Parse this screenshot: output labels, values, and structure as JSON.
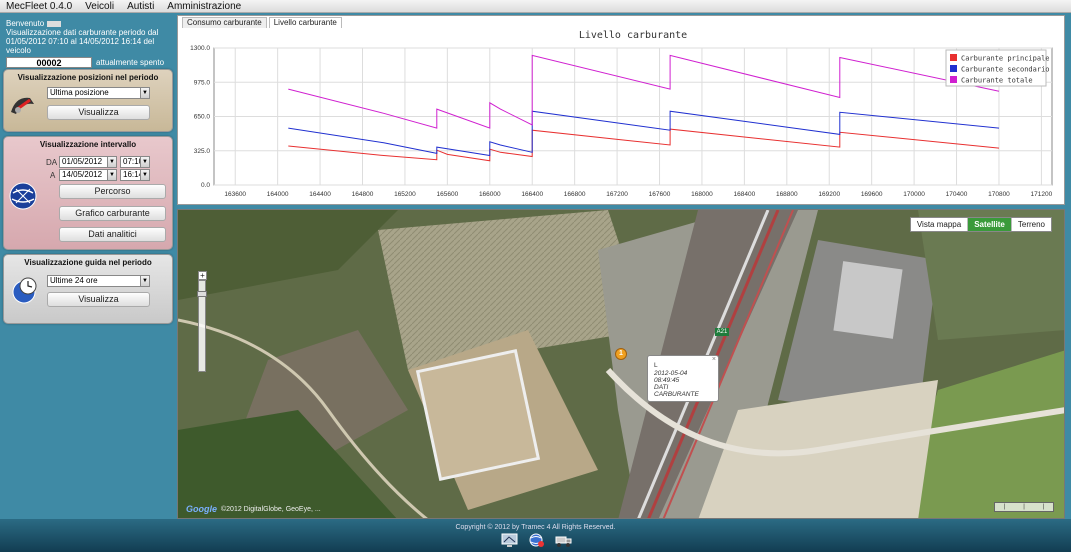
{
  "menu": {
    "app_title": "MecFleet 0.4.0",
    "items": [
      "Veicoli",
      "Autisti",
      "Amministrazione"
    ]
  },
  "welcome": {
    "greeting": "Benvenuto",
    "line1": "Visualizzazione dati carburante periodo dal",
    "line2": "01/05/2012 07:10 al 14/05/2012 16:14 del veicolo",
    "vehicle_code": "00002",
    "status": "attualmente spento"
  },
  "positions_panel": {
    "title": "Visualizzazione posizioni nel periodo",
    "select_value": "Ultima posizione",
    "button": "Visualizza"
  },
  "interval_panel": {
    "title": "Visualizzazione intervallo",
    "from_label": "DA",
    "to_label": "A",
    "from_date": "01/05/2012",
    "from_time": "07:10",
    "to_date": "14/05/2012",
    "to_time": "16:14",
    "buttons": [
      "Percorso",
      "Grafico carburante",
      "Dati analitici"
    ]
  },
  "driving_panel": {
    "title": "Visualizzazione guida nel periodo",
    "select_value": "Ultime 24 ore",
    "button": "Visualizza"
  },
  "chart_tabs": [
    "Consumo carburante",
    "Livello carburante"
  ],
  "chart_data": {
    "type": "line",
    "title": "Livello carburante",
    "xlim": [
      163400,
      171300
    ],
    "ylim": [
      0,
      1300
    ],
    "x_ticks": [
      163600,
      164000,
      164400,
      164800,
      165200,
      165600,
      166000,
      166400,
      166800,
      167200,
      167600,
      168000,
      168400,
      168800,
      169200,
      169600,
      170000,
      170400,
      170800,
      171200
    ],
    "y_ticks": [
      "0.0",
      "325.0",
      "650.0",
      "975.0",
      "1300.0"
    ],
    "grid": true,
    "legend_position": "top-right",
    "series": [
      {
        "name": "Carburante principale",
        "color": "#e83030",
        "points": [
          [
            164100,
            370
          ],
          [
            165000,
            280
          ],
          [
            165500,
            240
          ],
          [
            165500,
            330
          ],
          [
            165600,
            290
          ],
          [
            166000,
            230
          ],
          [
            166000,
            340
          ],
          [
            166100,
            310
          ],
          [
            166400,
            270
          ],
          [
            166400,
            520
          ],
          [
            167700,
            380
          ],
          [
            167700,
            530
          ],
          [
            169300,
            360
          ],
          [
            169300,
            500
          ],
          [
            170800,
            350
          ]
        ]
      },
      {
        "name": "Carburante secondario",
        "color": "#2030d0",
        "points": [
          [
            164100,
            540
          ],
          [
            165000,
            400
          ],
          [
            165500,
            300
          ],
          [
            165500,
            360
          ],
          [
            166000,
            280
          ],
          [
            166000,
            410
          ],
          [
            166100,
            380
          ],
          [
            166400,
            310
          ],
          [
            166400,
            700
          ],
          [
            167700,
            520
          ],
          [
            167700,
            700
          ],
          [
            169300,
            480
          ],
          [
            169300,
            690
          ],
          [
            170800,
            540
          ]
        ]
      },
      {
        "name": "Carburante totale",
        "color": "#d020d0",
        "points": [
          [
            164100,
            910
          ],
          [
            165000,
            680
          ],
          [
            165500,
            540
          ],
          [
            165500,
            720
          ],
          [
            166000,
            540
          ],
          [
            166000,
            780
          ],
          [
            166100,
            720
          ],
          [
            166400,
            570
          ],
          [
            166400,
            1230
          ],
          [
            167700,
            910
          ],
          [
            167700,
            1230
          ],
          [
            169300,
            830
          ],
          [
            169300,
            1210
          ],
          [
            170800,
            890
          ]
        ]
      }
    ]
  },
  "map": {
    "types": [
      "Vista mappa",
      "Satellite",
      "Terreno"
    ],
    "active_type": "Satellite",
    "info": {
      "line1": "L",
      "timestamp": "2012-05-04 08:49:45",
      "label": "DATI CARBURANTE"
    },
    "attribution": "©2012 DigitalGlobe, GeoEye, ...",
    "attribution_logo": "Google",
    "marker_label": "1",
    "road_sign": "A21"
  },
  "footer": {
    "copyright": "Copyright © 2012 by Tramec 4 All Rights Reserved."
  }
}
